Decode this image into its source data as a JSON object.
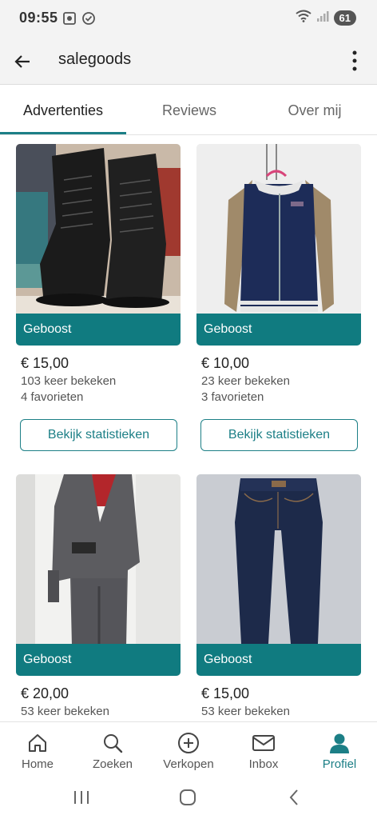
{
  "status_bar": {
    "time": "09:55",
    "battery": "61",
    "icons": [
      "screenshot-icon",
      "check-circle-icon",
      "wifi-icon",
      "signal-icon"
    ]
  },
  "app_bar": {
    "title": "salegoods",
    "back_icon": "arrow-left-icon",
    "menu_icon": "more-vertical-icon"
  },
  "tabs": [
    {
      "label": "Advertenties",
      "active": true
    },
    {
      "label": "Reviews",
      "active": false
    },
    {
      "label": "Over mij",
      "active": false
    }
  ],
  "listings": [
    {
      "image": "black lace-up boots",
      "badge": "Geboost",
      "price": "€ 15,00",
      "views": "103 keer bekeken",
      "favorites": "4 favorieten",
      "button": "Bekijk statistieken"
    },
    {
      "image": "navy satin bomber jacket",
      "badge": "Geboost",
      "price": "€ 10,00",
      "views": "23 keer bekeken",
      "favorites": "3 favorieten",
      "button": "Bekijk statistieken"
    },
    {
      "image": "grey tweed suit",
      "badge": "Geboost",
      "price": "€ 20,00",
      "views": "53 keer bekeken"
    },
    {
      "image": "dark blue jeans",
      "badge": "Geboost",
      "price": "€ 15,00",
      "views": "53 keer bekeken"
    }
  ],
  "bottom_nav": [
    {
      "label": "Home",
      "icon": "home-icon",
      "active": false
    },
    {
      "label": "Zoeken",
      "icon": "search-icon",
      "active": false
    },
    {
      "label": "Verkopen",
      "icon": "plus-circle-icon",
      "active": false
    },
    {
      "label": "Inbox",
      "icon": "mail-icon",
      "active": false
    },
    {
      "label": "Profiel",
      "icon": "person-icon",
      "active": true
    }
  ],
  "system_nav": [
    "recents-icon",
    "home-circle-icon",
    "back-chevron-icon"
  ],
  "colors": {
    "accent": "#1c7f86",
    "boost_band": "#107b80",
    "header_bg": "#f3f3f3"
  }
}
